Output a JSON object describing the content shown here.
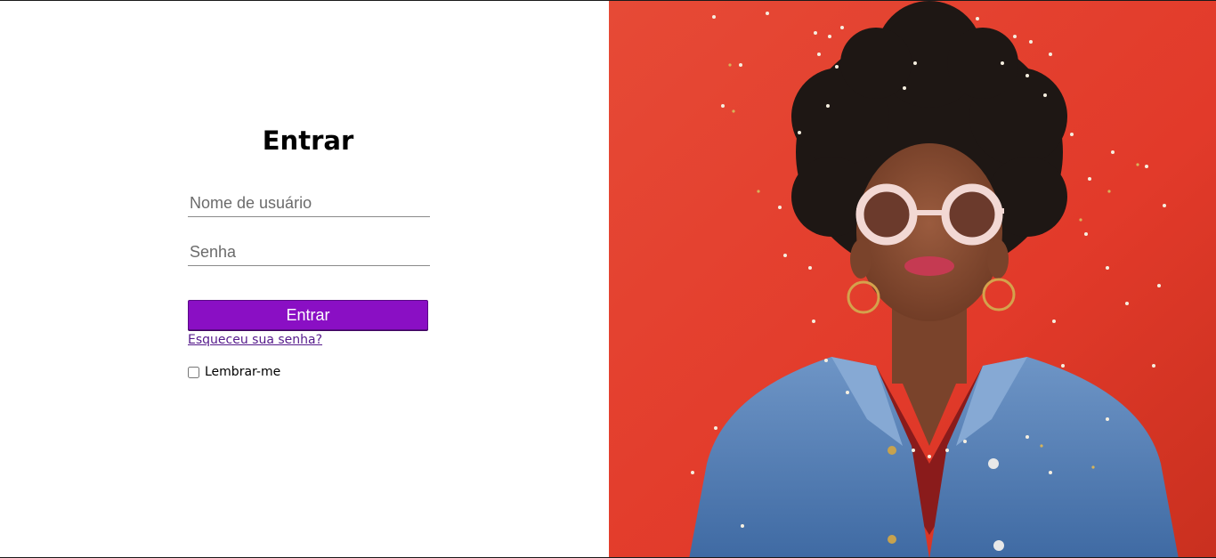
{
  "login": {
    "title": "Entrar",
    "username_placeholder": "Nome de usuário",
    "password_placeholder": "Senha",
    "submit_label": "Entrar",
    "forgot_label": "Esqueceu sua senha?",
    "remember_label": "Lembrar-me",
    "remember_checked": false
  },
  "photo": {
    "subject": "woman-portrait",
    "background_color": "#e8412f",
    "accent_color": "#8a0fc4"
  }
}
